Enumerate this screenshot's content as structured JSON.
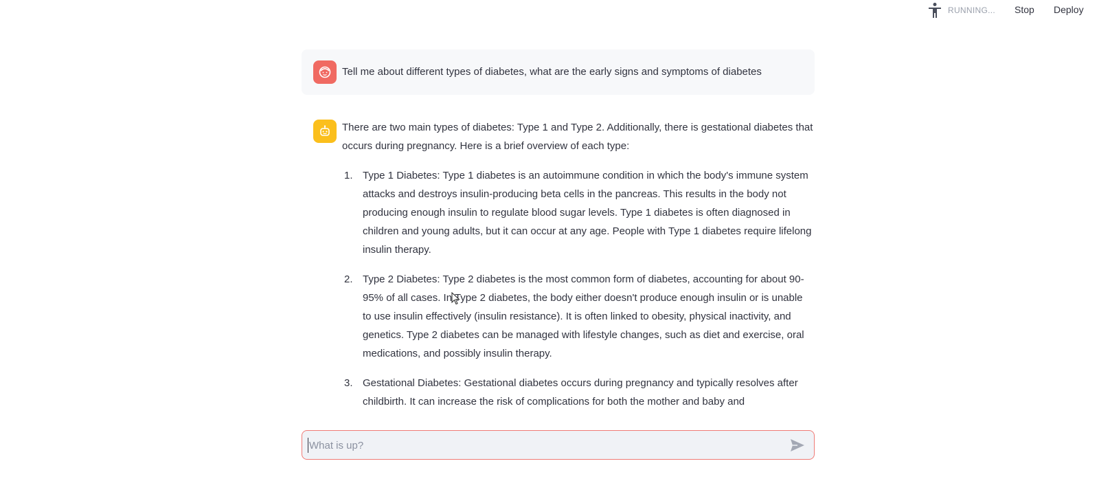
{
  "toolbar": {
    "status_text": "RUNNING...",
    "status_icon": "running-person-icon",
    "stop_label": "Stop",
    "deploy_label": "Deploy"
  },
  "chat": {
    "user_message": {
      "avatar_icon": "user-face-icon",
      "avatar_color": "#f06a62",
      "text": "Tell me about different types of diabetes, what are the early signs and symptoms of diabetes"
    },
    "assistant_message": {
      "avatar_icon": "robot-icon",
      "avatar_color": "#fbbf1c",
      "intro": "There are two main types of diabetes: Type 1 and Type 2. Additionally, there is gestational diabetes that occurs during pregnancy. Here is a brief overview of each type:",
      "items": [
        {
          "number": "1.",
          "text": "Type 1 Diabetes: Type 1 diabetes is an autoimmune condition in which the body's immune system attacks and destroys insulin-producing beta cells in the pancreas. This results in the body not producing enough insulin to regulate blood sugar levels. Type 1 diabetes is often diagnosed in children and young adults, but it can occur at any age. People with Type 1 diabetes require lifelong insulin therapy."
        },
        {
          "number": "2.",
          "text": "Type 2 Diabetes: Type 2 diabetes is the most common form of diabetes, accounting for about 90-95% of all cases. In Type 2 diabetes, the body either doesn't produce enough insulin or is unable to use insulin effectively (insulin resistance). It is often linked to obesity, physical inactivity, and genetics. Type 2 diabetes can be managed with lifestyle changes, such as diet and exercise, oral medications, and possibly insulin therapy."
        },
        {
          "number": "3.",
          "text": "Gestational Diabetes: Gestational diabetes occurs during pregnancy and typically resolves after childbirth. It can increase the risk of complications for both the mother and baby and"
        }
      ]
    }
  },
  "input": {
    "placeholder": "What is up?",
    "value": "",
    "send_icon": "send-arrow-icon",
    "border_color": "#f07a75"
  },
  "colors": {
    "text": "#31333f",
    "user_bg": "#f7f8fa",
    "input_bg": "#f0f2f6",
    "status": "#9aa0ac"
  }
}
